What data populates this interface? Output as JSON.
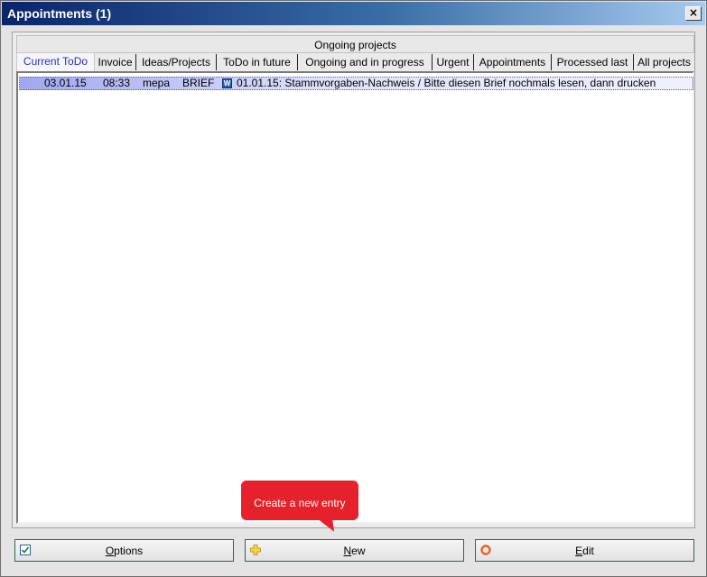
{
  "window": {
    "title": "Appointments (1)",
    "close_symbol": "×"
  },
  "tabs_top": {
    "label": "Ongoing projects"
  },
  "tabs": [
    {
      "label": "Current ToDo",
      "active": true
    },
    {
      "label": "Invoice"
    },
    {
      "label": "Ideas/Projects"
    },
    {
      "label": "ToDo in future"
    },
    {
      "label": "Ongoing and in progress"
    },
    {
      "label": "Urgent"
    },
    {
      "label": "Appointments"
    },
    {
      "label": "Processed last"
    },
    {
      "label": "All projects"
    }
  ],
  "list": {
    "rows": [
      {
        "date": "03.01.15",
        "time": "08:33",
        "user": "mepa",
        "type": "BRIEF",
        "icon": "word-document-icon",
        "description": "01.01.15: Stammvorgaben-Nachweis / Bitte diesen Brief nochmals lesen, dann drucken"
      }
    ]
  },
  "callout": {
    "text": "Create a new entry",
    "color": "#e7212b"
  },
  "buttons": {
    "options": {
      "accel": "O",
      "rest": "ptions",
      "icon": "checklist-icon"
    },
    "new": {
      "accel": "N",
      "rest": "ew",
      "icon": "plus-icon"
    },
    "edit": {
      "accel": "E",
      "rest": "dit",
      "icon": "edit-ring-icon"
    }
  },
  "colors": {
    "title_bar": "#0a246a",
    "active_tab_text": "#2030d0",
    "button_border": "#2f6a3a"
  }
}
